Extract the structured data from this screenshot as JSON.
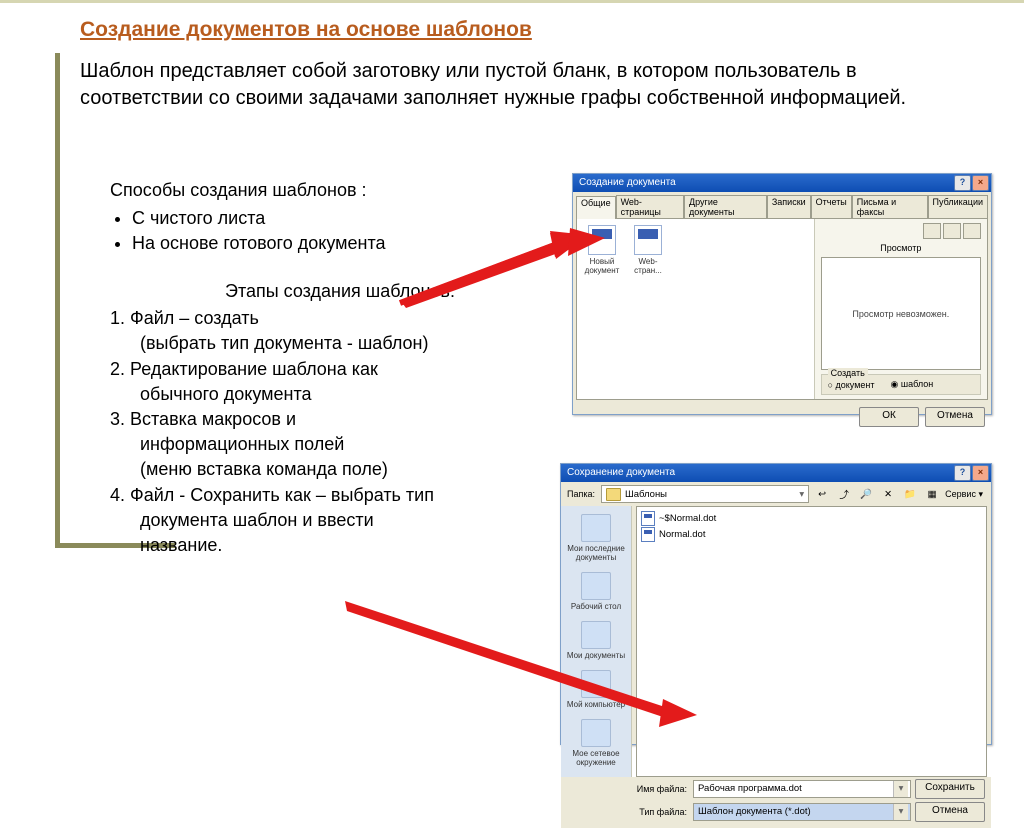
{
  "title": "Создание документов на основе шаблонов",
  "para": "Шаблон представляет собой заготовку или пустой бланк, в котором пользователь в соответствии со своими задачами заполняет нужные графы собственной информацией.",
  "block1": {
    "head": "Способы создания шаблонов :",
    "items": [
      "С чистого листа",
      "На основе готового документа"
    ]
  },
  "block2": {
    "head": "Этапы создания шаблонов:",
    "s1a": "1. Файл – создать",
    "s1b": "(выбрать тип документа - шаблон)",
    "s2a": "2. Редактирование шаблона как",
    "s2b": "обычного документа",
    "s3a": "3. Вставка макросов и",
    "s3b": "информационных полей",
    "s3c": "(меню вставка команда поле)",
    "s4a": "4. Файл - Сохранить как – выбрать тип",
    "s4b": "документа шаблон и ввести",
    "s4c": "название."
  },
  "dlg1": {
    "title": "Создание документа",
    "tabs": [
      "Общие",
      "Web-страницы",
      "Другие документы",
      "Записки",
      "Отчеты",
      "Письма и факсы",
      "Публикации"
    ],
    "doc1": "Новый документ",
    "doc2": "Web-стран...",
    "preview_label": "Просмотр",
    "preview_text": "Просмотр невозможен.",
    "create_legend": "Создать",
    "radio_doc": "документ",
    "radio_tpl": "шаблон",
    "ok": "ОК",
    "cancel": "Отмена"
  },
  "dlg2": {
    "title": "Сохранение документа",
    "folder_label": "Папка:",
    "folder_value": "Шаблоны",
    "tools": "Сервис",
    "places": [
      "Мои последние документы",
      "Рабочий стол",
      "Мои документы",
      "Мой компьютер",
      "Мое сетевое окружение"
    ],
    "files": [
      "~$Normal.dot",
      "Normal.dot"
    ],
    "fname_label": "Имя файла:",
    "fname_value": "Рабочая программа.dot",
    "ftype_label": "Тип файла:",
    "ftype_value": "Шаблон документа (*.dot)",
    "save": "Сохранить",
    "cancel": "Отмена"
  }
}
